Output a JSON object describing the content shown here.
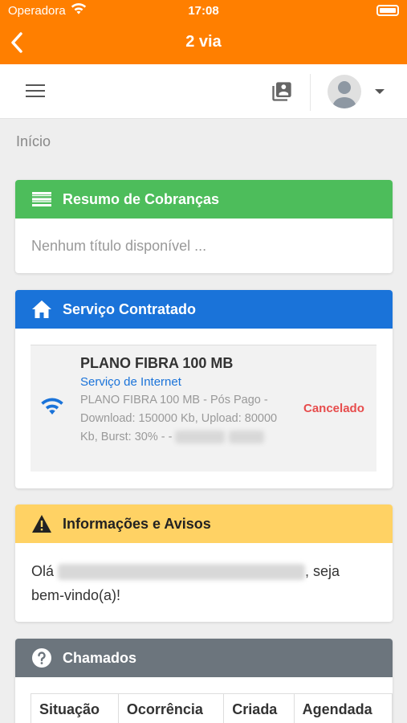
{
  "status_bar": {
    "carrier": "Operadora",
    "time": "17:08"
  },
  "nav": {
    "title": "2 via"
  },
  "breadcrumb": "Início",
  "billing": {
    "title": "Resumo de Cobranças",
    "empty_text": "Nenhum título disponível ..."
  },
  "service": {
    "title": "Serviço Contratado",
    "plan_name": "PLANO FIBRA 100 MB",
    "plan_type": "Serviço de Internet",
    "plan_description": "PLANO FIBRA 100 MB - Pós Pago - Download: 150000 Kb, Upload: 80000 Kb, Burst: 30% - -",
    "status": "Cancelado"
  },
  "info": {
    "title": "Informações e Avisos",
    "greeting_prefix": "Olá",
    "greeting_suffix": ", seja bem-vindo(a)!"
  },
  "tickets": {
    "title": "Chamados",
    "columns": [
      "Situação",
      "Ocorrência",
      "Criada",
      "Agendada"
    ]
  },
  "colors": {
    "brand_orange": "#ff7f00",
    "billing_green": "#4dbd5b",
    "service_blue": "#1a73d9",
    "info_yellow": "#ffd264",
    "tickets_gray": "#6c757d",
    "status_red": "#e74c4c"
  },
  "icons": {
    "back": "chevron-left-icon",
    "menu": "hamburger-menu-icon",
    "contacts": "contacts-book-icon",
    "avatar": "user-avatar-icon",
    "billing": "list-icon",
    "service": "home-icon",
    "service_item": "wifi-icon",
    "info": "warning-icon",
    "tickets": "question-icon"
  }
}
